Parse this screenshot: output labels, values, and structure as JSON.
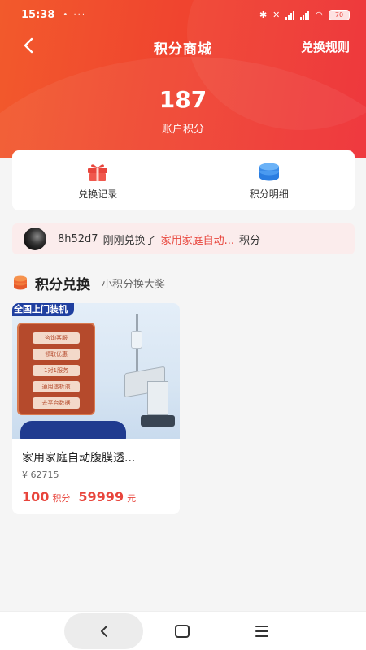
{
  "status_bar": {
    "time": "15:38",
    "extra": "•  ···",
    "battery": "70",
    "net_label": "HD"
  },
  "header": {
    "title": "积分商城",
    "rules_link": "兑换规则"
  },
  "account": {
    "points": "187",
    "points_label": "账户积分"
  },
  "shortcuts": [
    {
      "label": "兑换记录",
      "icon": "gift-icon"
    },
    {
      "label": "积分明细",
      "icon": "coin-stack-icon"
    }
  ],
  "ticker": {
    "user": "8h52d7",
    "action": "刚刚兑换了",
    "item": "家用家庭自动...",
    "suffix": "积分"
  },
  "section": {
    "title": "积分兑换",
    "subtitle": "小积分换大奖"
  },
  "products": [
    {
      "image_banner": "全国上门装机",
      "image_tags": [
        "咨询客服",
        "领取优惠",
        "1对1服务",
        "通用透析液",
        "去平台数据"
      ],
      "name": "家用家庭自动腹膜透...",
      "original_price": "¥ 62715",
      "points": "100",
      "points_unit": "积分",
      "cash": "59999",
      "cash_unit": "元"
    }
  ],
  "colors": {
    "accent": "#e8453c",
    "header_start": "#f25a2c",
    "header_end": "#ee2d33"
  }
}
